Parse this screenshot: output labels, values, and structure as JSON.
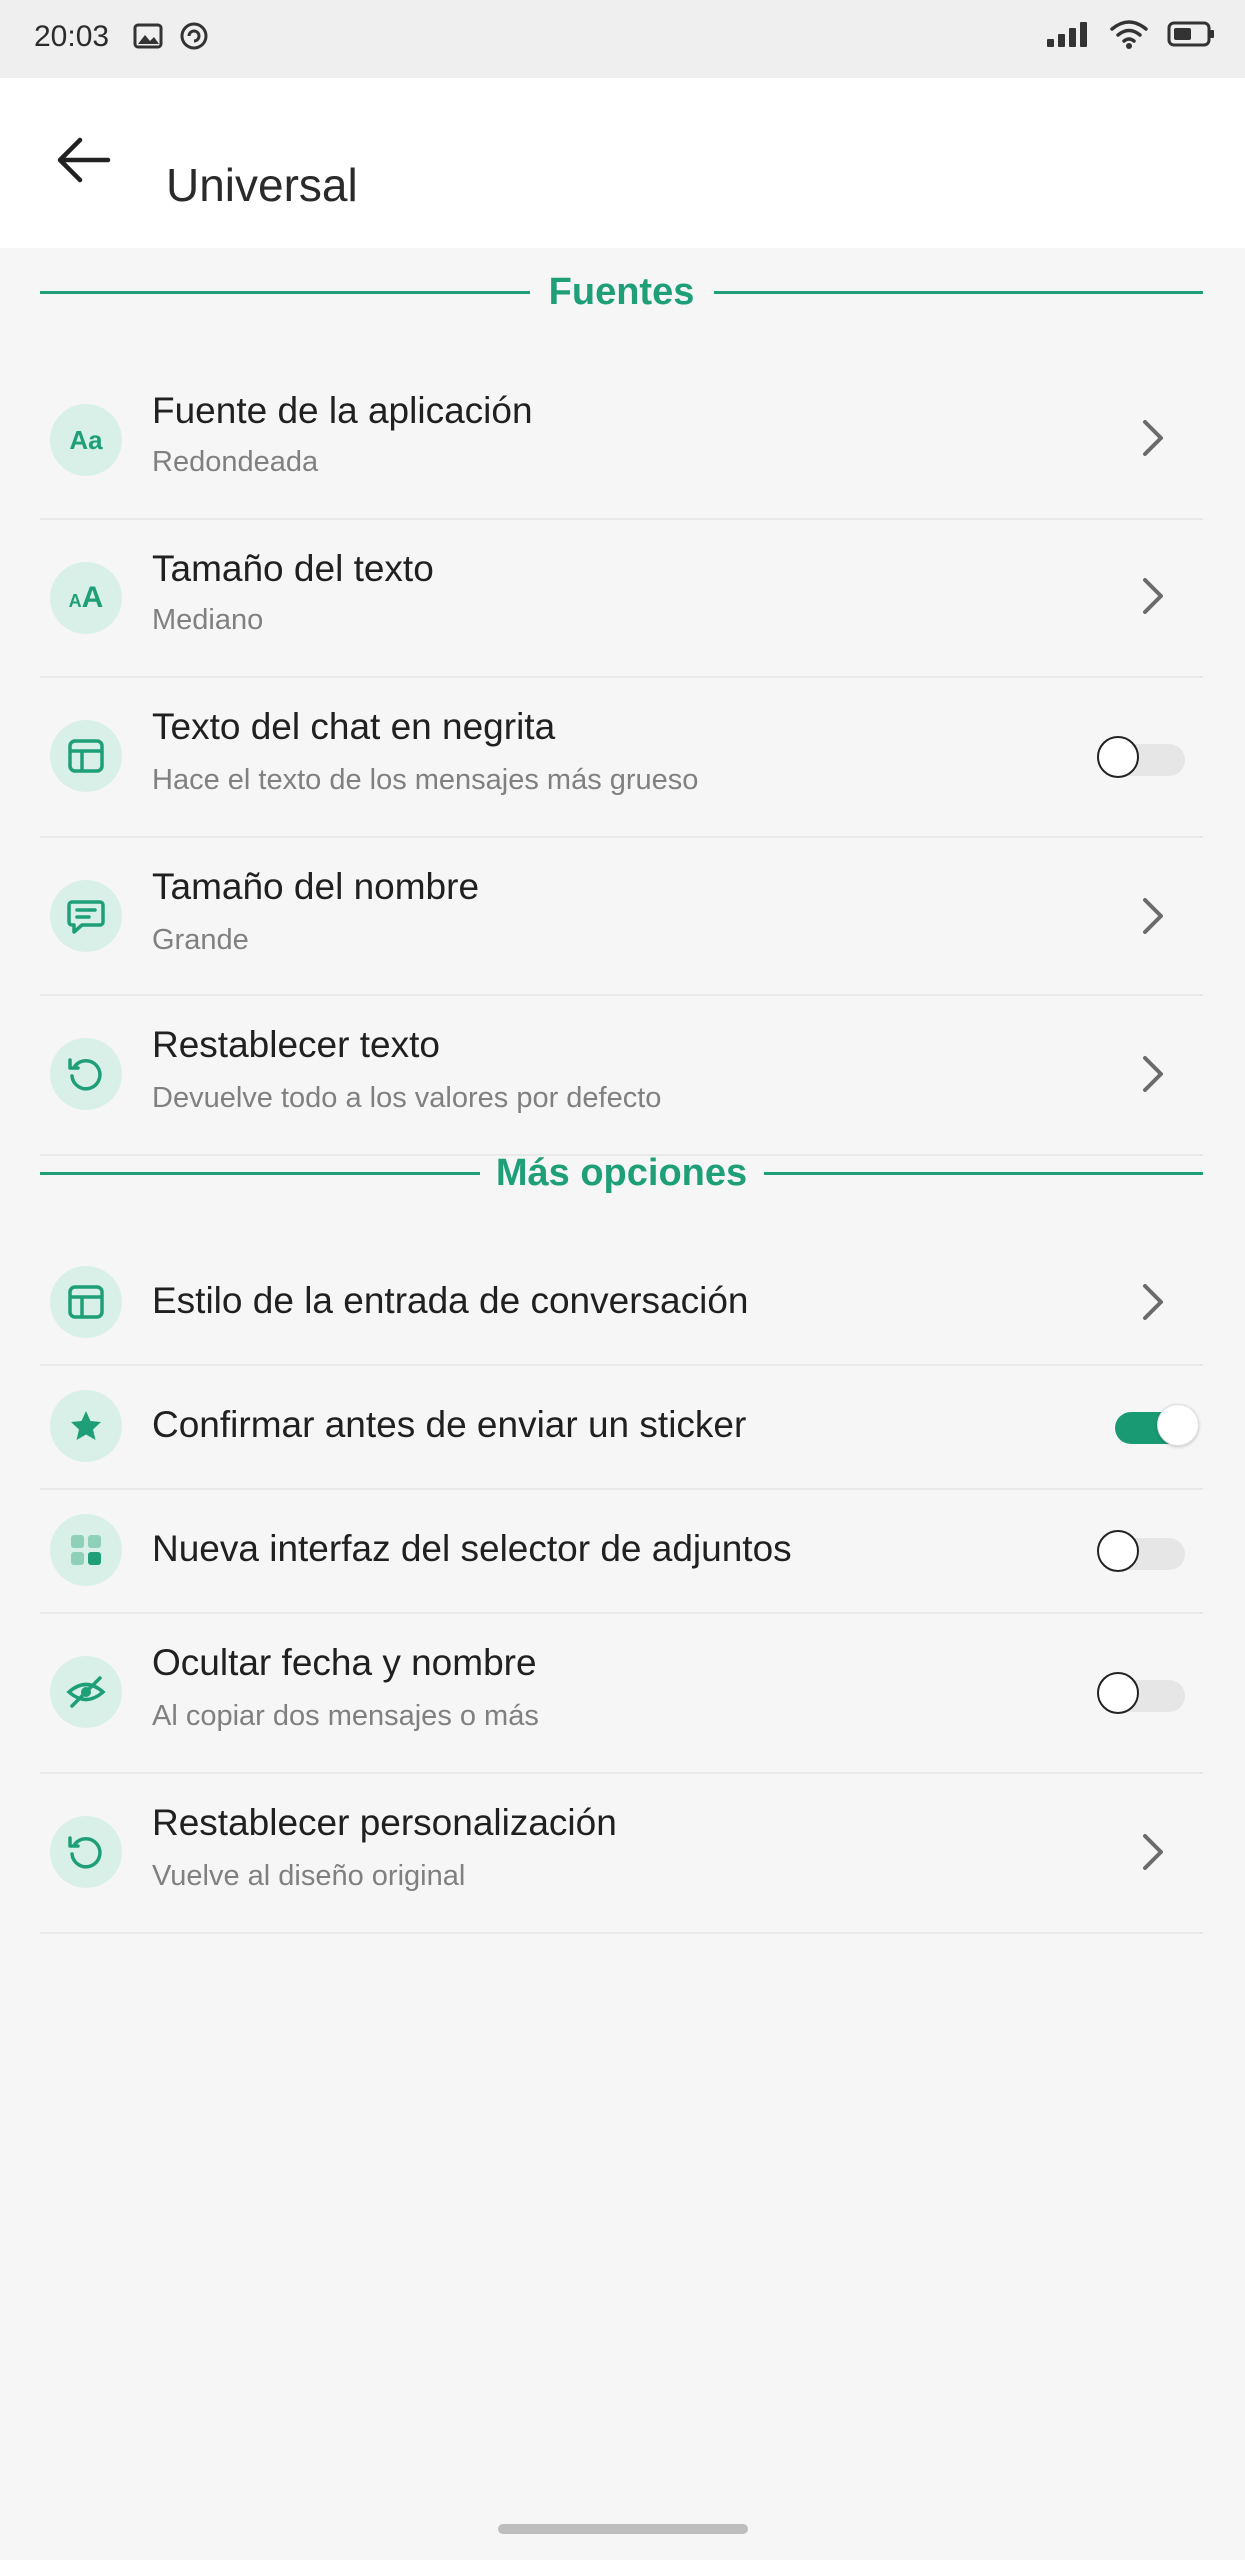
{
  "status_bar": {
    "time": "20:03",
    "left_icons": [
      "image-icon",
      "sync-icon"
    ],
    "right_icons": [
      "signal-icon",
      "wifi-icon",
      "battery-icon"
    ]
  },
  "app_bar": {
    "back_icon": "arrow-left-icon",
    "title": "Universal"
  },
  "colors": {
    "accent": "#1e9f78",
    "icon_bg": "#d8f0e7",
    "background": "#f6f6f6"
  },
  "sections": [
    {
      "label": "Fuentes",
      "items": [
        {
          "icon": "font-aa-icon",
          "title": "Fuente de la aplicación",
          "subtitle": "Redondeada",
          "control": "chevron"
        },
        {
          "icon": "text-size-icon",
          "title": "Tamaño del texto",
          "subtitle": "Mediano",
          "control": "chevron"
        },
        {
          "icon": "layout-icon",
          "title": "Texto del chat en negrita",
          "subtitle": "Hace el texto de los mensajes más grueso",
          "control": "toggle",
          "toggle_on": false
        },
        {
          "icon": "chat-bubble-icon",
          "title": "Tamaño del nombre",
          "subtitle": "Grande",
          "control": "chevron"
        },
        {
          "icon": "reset-icon",
          "title": "Restablecer texto",
          "subtitle": "Devuelve todo a los valores por defecto",
          "control": "chevron"
        }
      ]
    },
    {
      "label": "Más opciones",
      "items": [
        {
          "icon": "layout-icon",
          "title": "Estilo de la entrada de conversación",
          "control": "chevron"
        },
        {
          "icon": "star-icon",
          "title": "Confirmar antes de enviar un sticker",
          "control": "toggle",
          "toggle_on": true
        },
        {
          "icon": "grid-icon",
          "title": "Nueva interfaz del selector de adjuntos",
          "control": "toggle",
          "toggle_on": false
        },
        {
          "icon": "eye-off-icon",
          "title": "Ocultar fecha y nombre",
          "subtitle": "Al copiar dos mensajes o más",
          "control": "toggle",
          "toggle_on": false
        },
        {
          "icon": "reset-icon",
          "title": "Restablecer personalización",
          "subtitle": "Vuelve al diseño original",
          "control": "chevron"
        }
      ]
    }
  ]
}
